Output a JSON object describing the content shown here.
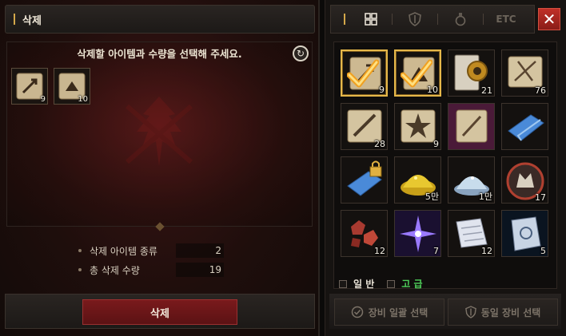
{
  "left_panel": {
    "title": "삭제",
    "instruction": "삭제할 아이템과 수량을 선택해 주세요.",
    "selected_items": [
      {
        "icon": "scroll-arrow-icon",
        "count": "9"
      },
      {
        "icon": "scroll-claw-icon",
        "count": "10"
      }
    ],
    "summary": {
      "kinds_label": "삭제 아이템 종류",
      "kinds_value": "2",
      "total_label": "총 삭제 수량",
      "total_value": "19"
    },
    "delete_button": "삭제"
  },
  "right_panel": {
    "tabs": [
      {
        "name": "all",
        "icon": "grid-icon"
      },
      {
        "name": "equipment",
        "icon": "shield-icon"
      },
      {
        "name": "consumable",
        "icon": "potion-icon"
      },
      {
        "name": "etc",
        "label": "ETC"
      }
    ],
    "close_label": "✕",
    "inventory": [
      {
        "icon": "scroll-arrow-icon",
        "count": "9",
        "selected": true
      },
      {
        "icon": "scroll-claw-icon",
        "count": "10",
        "selected": true
      },
      {
        "icon": "gear-scroll-icon",
        "count": "21"
      },
      {
        "icon": "scroll-slash-icon",
        "count": "76"
      },
      {
        "icon": "scroll-sword-icon",
        "count": "28"
      },
      {
        "icon": "scroll-burst-icon",
        "count": "9"
      },
      {
        "icon": "scroll-purple-icon",
        "count": ""
      },
      {
        "icon": "blue-cloth-icon",
        "count": ""
      },
      {
        "icon": "locked-blue-cloth-icon",
        "count": ""
      },
      {
        "icon": "gold-dust-icon",
        "count": "5만"
      },
      {
        "icon": "crystal-dust-icon",
        "count": "1만"
      },
      {
        "icon": "wolf-emblem-icon",
        "count": "17"
      },
      {
        "icon": "red-ore-icon",
        "count": "12"
      },
      {
        "icon": "star-crystal-icon",
        "count": "7"
      },
      {
        "icon": "paper-note-icon",
        "count": "12"
      },
      {
        "icon": "torn-map-icon",
        "count": "5"
      }
    ],
    "filters": [
      {
        "label": "일 반",
        "color": "#e8e2d6"
      },
      {
        "label": "고 급",
        "color": "#4fd05a"
      }
    ],
    "action_buttons": [
      {
        "label": "장비 일괄 선택",
        "icon": "check-circle-icon"
      },
      {
        "label": "동일 장비 선택",
        "icon": "shield-icon"
      }
    ]
  },
  "colors": {
    "accent_gold": "#d4a84a",
    "delete_red": "#7a1a1c",
    "close_red": "#c03028",
    "advanced_green": "#4fd05a"
  }
}
